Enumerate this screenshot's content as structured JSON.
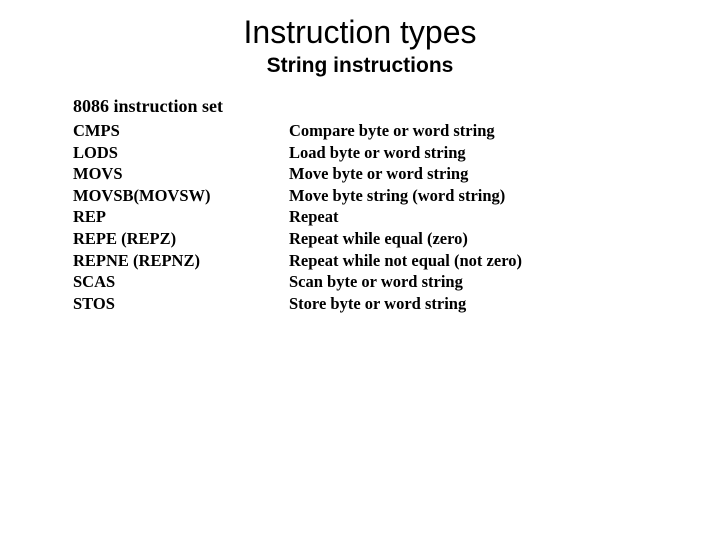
{
  "slide": {
    "title": "Instruction types",
    "subtitle": "String instructions",
    "section_heading": "8086 instruction set",
    "instructions": [
      {
        "mnemonic": "CMPS",
        "description": "Compare byte or word string"
      },
      {
        "mnemonic": "LODS",
        "description": "Load byte or word string"
      },
      {
        "mnemonic": "MOVS",
        "description": "Move byte or word string"
      },
      {
        "mnemonic": "MOVSB(MOVSW)",
        "description": "Move byte string (word string)"
      },
      {
        "mnemonic": "REP",
        "description": "Repeat"
      },
      {
        "mnemonic": "REPE (REPZ)",
        "description": "Repeat while equal (zero)"
      },
      {
        "mnemonic": "REPNE (REPNZ)",
        "description": "Repeat while not equal (not zero)"
      },
      {
        "mnemonic": "SCAS",
        "description": "Scan byte or word string"
      },
      {
        "mnemonic": "STOS",
        "description": "Store byte or word string"
      }
    ]
  }
}
